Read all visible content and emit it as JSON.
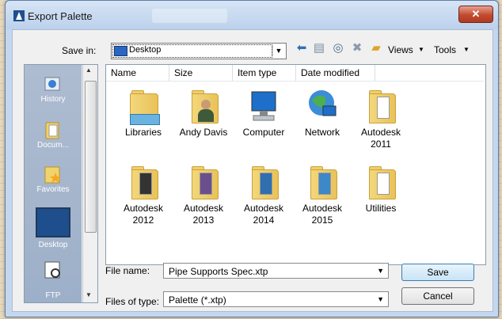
{
  "window": {
    "title": "Export Palette",
    "close_glyph": "✕"
  },
  "save_in": {
    "label": "Save in:",
    "value": "Desktop"
  },
  "toolbar": {
    "views_label": "Views",
    "tools_label": "Tools"
  },
  "places": [
    {
      "label": "History",
      "icon": "history-icon"
    },
    {
      "label": "Docum...",
      "icon": "documents-icon"
    },
    {
      "label": "Favorites",
      "icon": "favorites-icon"
    },
    {
      "label": "Desktop",
      "icon": "desktop-icon"
    },
    {
      "label": "FTP",
      "icon": "ftp-icon"
    }
  ],
  "columns": [
    "Name",
    "Size",
    "Item type",
    "Date modified"
  ],
  "items": [
    {
      "name": "Libraries",
      "icon": "libraries-icon"
    },
    {
      "name": "Andy Davis",
      "icon": "user-folder-icon"
    },
    {
      "name": "Computer",
      "icon": "computer-icon"
    },
    {
      "name": "Network",
      "icon": "network-icon"
    },
    {
      "name": "Autodesk 2011",
      "icon": "folder-icon"
    },
    {
      "name": "Autodesk 2012",
      "icon": "folder-icon"
    },
    {
      "name": "Autodesk 2013",
      "icon": "folder-icon"
    },
    {
      "name": "Autodesk 2014",
      "icon": "folder-icon"
    },
    {
      "name": "Autodesk 2015",
      "icon": "folder-icon"
    },
    {
      "name": "Utilities",
      "icon": "folder-icon"
    }
  ],
  "file_name": {
    "label": "File name:",
    "value": "Pipe Supports Spec.xtp"
  },
  "file_type": {
    "label": "Files of type:",
    "value": "Palette (*.xtp)"
  },
  "buttons": {
    "save": "Save",
    "cancel": "Cancel"
  }
}
